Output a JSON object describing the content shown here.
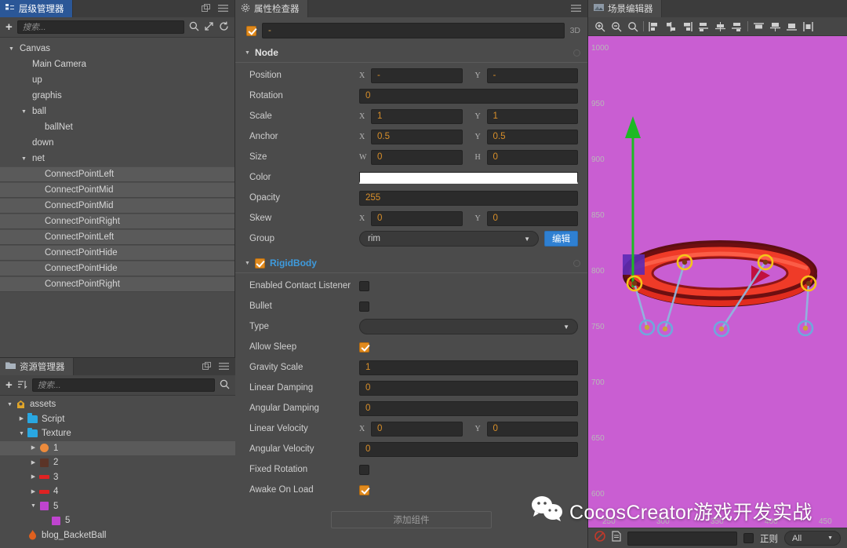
{
  "hierarchy": {
    "tab_label": "层级管理器",
    "tab_icon": "hierarchy-icon",
    "search_placeholder": "搜索...",
    "items": [
      {
        "label": "Canvas",
        "depth": 0,
        "expanded": true,
        "has_children": true,
        "selected": false
      },
      {
        "label": "Main Camera",
        "depth": 1,
        "expanded": false,
        "has_children": false,
        "selected": false
      },
      {
        "label": "up",
        "depth": 1,
        "expanded": false,
        "has_children": false,
        "selected": false
      },
      {
        "label": "graphis",
        "depth": 1,
        "expanded": false,
        "has_children": false,
        "selected": false
      },
      {
        "label": "ball",
        "depth": 1,
        "expanded": true,
        "has_children": true,
        "selected": false
      },
      {
        "label": "ballNet",
        "depth": 2,
        "expanded": false,
        "has_children": false,
        "selected": false
      },
      {
        "label": "down",
        "depth": 1,
        "expanded": false,
        "has_children": false,
        "selected": false
      },
      {
        "label": "net",
        "depth": 1,
        "expanded": true,
        "has_children": true,
        "selected": false
      },
      {
        "label": "ConnectPointLeft",
        "depth": 2,
        "expanded": false,
        "has_children": false,
        "selected": true
      },
      {
        "label": "ConnectPointMid",
        "depth": 2,
        "expanded": false,
        "has_children": false,
        "selected": true
      },
      {
        "label": "ConnectPointMid",
        "depth": 2,
        "expanded": false,
        "has_children": false,
        "selected": true
      },
      {
        "label": "ConnectPointRight",
        "depth": 2,
        "expanded": false,
        "has_children": false,
        "selected": true
      },
      {
        "label": "ConnectPointLeft",
        "depth": 2,
        "expanded": false,
        "has_children": false,
        "selected": true
      },
      {
        "label": "ConnectPointHide",
        "depth": 2,
        "expanded": false,
        "has_children": false,
        "selected": true
      },
      {
        "label": "ConnectPointHide",
        "depth": 2,
        "expanded": false,
        "has_children": false,
        "selected": true
      },
      {
        "label": "ConnectPointRight",
        "depth": 2,
        "expanded": false,
        "has_children": false,
        "selected": true
      }
    ]
  },
  "assets": {
    "tab_label": "资源管理器",
    "tab_icon": "folder-icon",
    "search_placeholder": "搜索...",
    "items": [
      {
        "label": "assets",
        "depth": 0,
        "expanded": true,
        "has_children": true,
        "icon": "assets-db-icon",
        "color": "#e0a52a",
        "selected": false
      },
      {
        "label": "Script",
        "depth": 1,
        "expanded": false,
        "has_children": true,
        "icon": "folder-icon",
        "color": "#29a7e1",
        "selected": false
      },
      {
        "label": "Texture",
        "depth": 1,
        "expanded": true,
        "has_children": true,
        "icon": "folder-icon",
        "color": "#29a7e1",
        "selected": false
      },
      {
        "label": "1",
        "depth": 2,
        "expanded": false,
        "has_children": true,
        "icon": "texture-icon",
        "color": "#ec8b3c",
        "selected": true
      },
      {
        "label": "2",
        "depth": 2,
        "expanded": false,
        "has_children": true,
        "icon": "texture-icon",
        "color": "#5b3427",
        "selected": false
      },
      {
        "label": "3",
        "depth": 2,
        "expanded": false,
        "has_children": true,
        "icon": "texture-icon",
        "color": "#e02222",
        "selected": false
      },
      {
        "label": "4",
        "depth": 2,
        "expanded": false,
        "has_children": true,
        "icon": "texture-icon",
        "color": "#e02222",
        "selected": false
      },
      {
        "label": "5",
        "depth": 2,
        "expanded": true,
        "has_children": true,
        "icon": "texture-icon",
        "color": "#bf44cf",
        "selected": false
      },
      {
        "label": "5",
        "depth": 3,
        "expanded": false,
        "has_children": false,
        "icon": "sprite-icon",
        "color": "#bf44cf",
        "selected": false
      },
      {
        "label": "blog_BacketBall",
        "depth": 1,
        "expanded": false,
        "has_children": false,
        "icon": "fire-icon",
        "color": "#e0601e",
        "selected": false
      }
    ]
  },
  "inspector": {
    "tab_label": "属性检查器",
    "tab_icon": "gear-icon",
    "node_enabled": true,
    "node_name": "-",
    "mode_label": "3D",
    "node_section": {
      "title": "Node",
      "expanded": true,
      "rows": [
        {
          "label": "Position",
          "kind": "xy",
          "x": "-",
          "y": "-"
        },
        {
          "label": "Rotation",
          "kind": "single",
          "value": "0"
        },
        {
          "label": "Scale",
          "kind": "xy",
          "x": "1",
          "y": "1"
        },
        {
          "label": "Anchor",
          "kind": "xy",
          "x": "0.5",
          "y": "0.5"
        },
        {
          "label": "Size",
          "kind": "wh",
          "x": "0",
          "y": "0"
        },
        {
          "label": "Color",
          "kind": "color",
          "value": "#ffffff"
        },
        {
          "label": "Opacity",
          "kind": "single",
          "value": "255"
        },
        {
          "label": "Skew",
          "kind": "xy",
          "x": "0",
          "y": "0"
        },
        {
          "label": "Group",
          "kind": "group",
          "value": "rim",
          "button": "编辑"
        }
      ]
    },
    "rigidbody_section": {
      "title": "RigidBody",
      "expanded": true,
      "enabled": true,
      "rows": [
        {
          "label": "Enabled Contact Listener",
          "kind": "check",
          "checked": false
        },
        {
          "label": "Bullet",
          "kind": "check",
          "checked": false
        },
        {
          "label": "Type",
          "kind": "select",
          "value": ""
        },
        {
          "label": "Allow Sleep",
          "kind": "check",
          "checked": true
        },
        {
          "label": "Gravity Scale",
          "kind": "single",
          "value": "1"
        },
        {
          "label": "Linear Damping",
          "kind": "single",
          "value": "0"
        },
        {
          "label": "Angular Damping",
          "kind": "single",
          "value": "0"
        },
        {
          "label": "Linear Velocity",
          "kind": "xy",
          "x": "0",
          "y": "0"
        },
        {
          "label": "Angular Velocity",
          "kind": "single",
          "value": "0"
        },
        {
          "label": "Fixed Rotation",
          "kind": "check",
          "checked": false
        },
        {
          "label": "Awake On Load",
          "kind": "check",
          "checked": true
        }
      ]
    },
    "add_component_label": "添加组件"
  },
  "scene": {
    "tab_label": "场景编辑器",
    "tab_icon": "scene-icon",
    "background_color": "#c95ed2",
    "toolbar_icons": [
      "zoom-in-icon",
      "zoom-out-icon",
      "zoom-reset-icon",
      "divider",
      "align-left-icon",
      "align-center-h-icon",
      "align-right-icon",
      "distribute-left-icon",
      "distribute-center-icon",
      "distribute-right-icon",
      "divider",
      "align-top-icon",
      "align-middle-icon",
      "align-bottom-icon",
      "distribute-v-icon"
    ],
    "ruler_v_labels": [
      "1000",
      "950",
      "900",
      "850",
      "800",
      "750",
      "700",
      "650",
      "600"
    ],
    "ruler_h_labels": [
      "250",
      "300",
      "350",
      "400",
      "450"
    ],
    "gizmo_color": "#1db924",
    "rim_color": "#e02c1e",
    "anchor_color": "#f5c518",
    "joint_color": "#6fa8dc"
  },
  "statusbar": {
    "block_icon": "no-entry-icon",
    "file_icon": "file-icon",
    "filter_value": "",
    "regex_checked": false,
    "regex_label": "正则",
    "filter_type": "All"
  },
  "watermark": {
    "icon": "wechat-icon",
    "text": "CocosCreator游戏开发实战"
  }
}
